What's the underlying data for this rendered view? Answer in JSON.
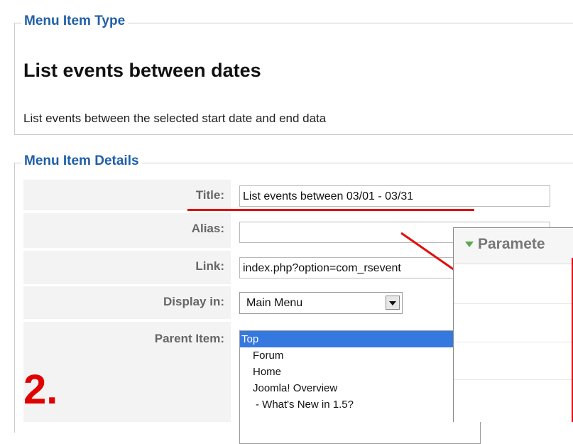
{
  "menu_item_type": {
    "legend": "Menu Item Type",
    "title": "List events between dates",
    "description": "List events between the selected start date and end data"
  },
  "menu_item_details": {
    "legend": "Menu Item Details",
    "title_label": "Title:",
    "title_value": "List events between 03/01 - 03/31",
    "alias_label": "Alias:",
    "alias_value": "",
    "link_label": "Link:",
    "link_value": "index.php?option=com_rsevent",
    "display_in_label": "Display in:",
    "display_in_value": "Main Menu",
    "parent_item_label": "Parent Item:",
    "parent_items": [
      "Top",
      "Forum",
      "Home",
      "Joomla! Overview",
      "- What's New in 1.5?"
    ]
  },
  "step_number": "2.",
  "parameters_panel": {
    "title": "Paramete"
  },
  "colors": {
    "legend_blue": "#1f5fa8",
    "annotation_red": "#e01010",
    "selected_blue": "#3478e0"
  }
}
